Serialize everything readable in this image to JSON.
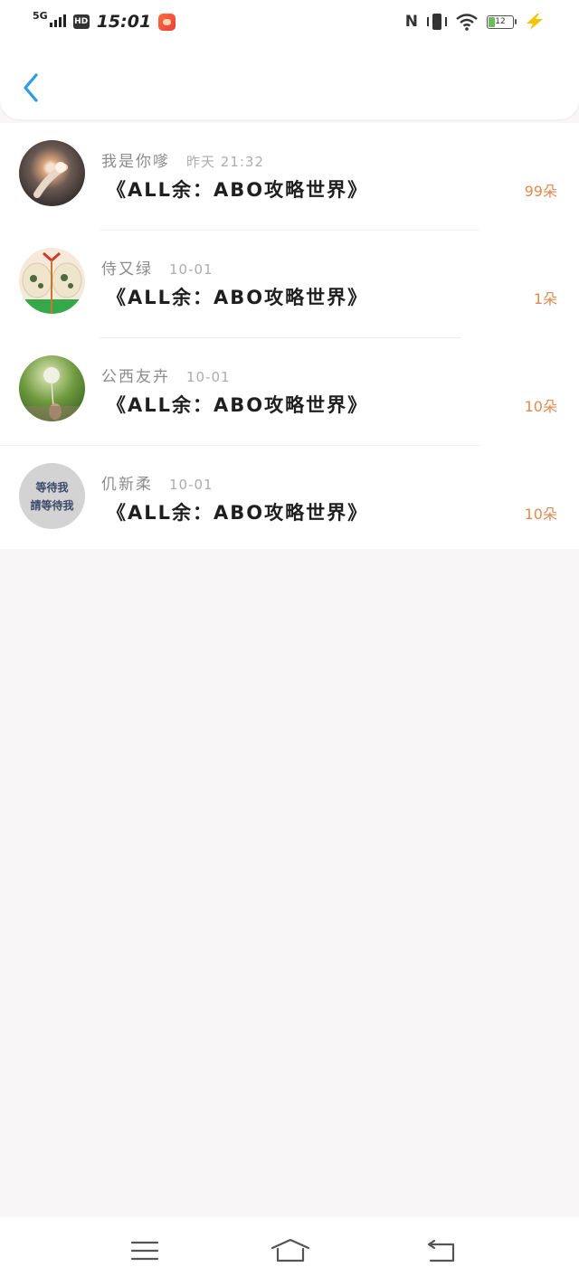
{
  "status_bar": {
    "network": "5G",
    "hd": "HD",
    "time": "15:01",
    "battery": "12"
  },
  "gifts": [
    {
      "name": "我是你嗲",
      "date": "昨天  21:32",
      "book": "《ALL余：ABO攻略世界》",
      "count": "99朵"
    },
    {
      "name": "侍又绿",
      "date": "10-01",
      "book": "《ALL余：ABO攻略世界》",
      "count": "1朵"
    },
    {
      "name": "公西友卉",
      "date": "10-01",
      "book": "《ALL余：ABO攻略世界》",
      "count": "10朵"
    },
    {
      "name": "仉新柔",
      "date": "10-01",
      "book": "《ALL余：ABO攻略世界》",
      "count": "10朵"
    }
  ],
  "avatar4_text": {
    "line1": "等待我",
    "line2": "請等待我"
  },
  "icons": {
    "back": "chevron-left-icon",
    "menu": "menu-icon",
    "home": "home-icon",
    "return": "return-icon"
  },
  "colors": {
    "accent": "#2e9be6",
    "count": "#e18a52"
  }
}
